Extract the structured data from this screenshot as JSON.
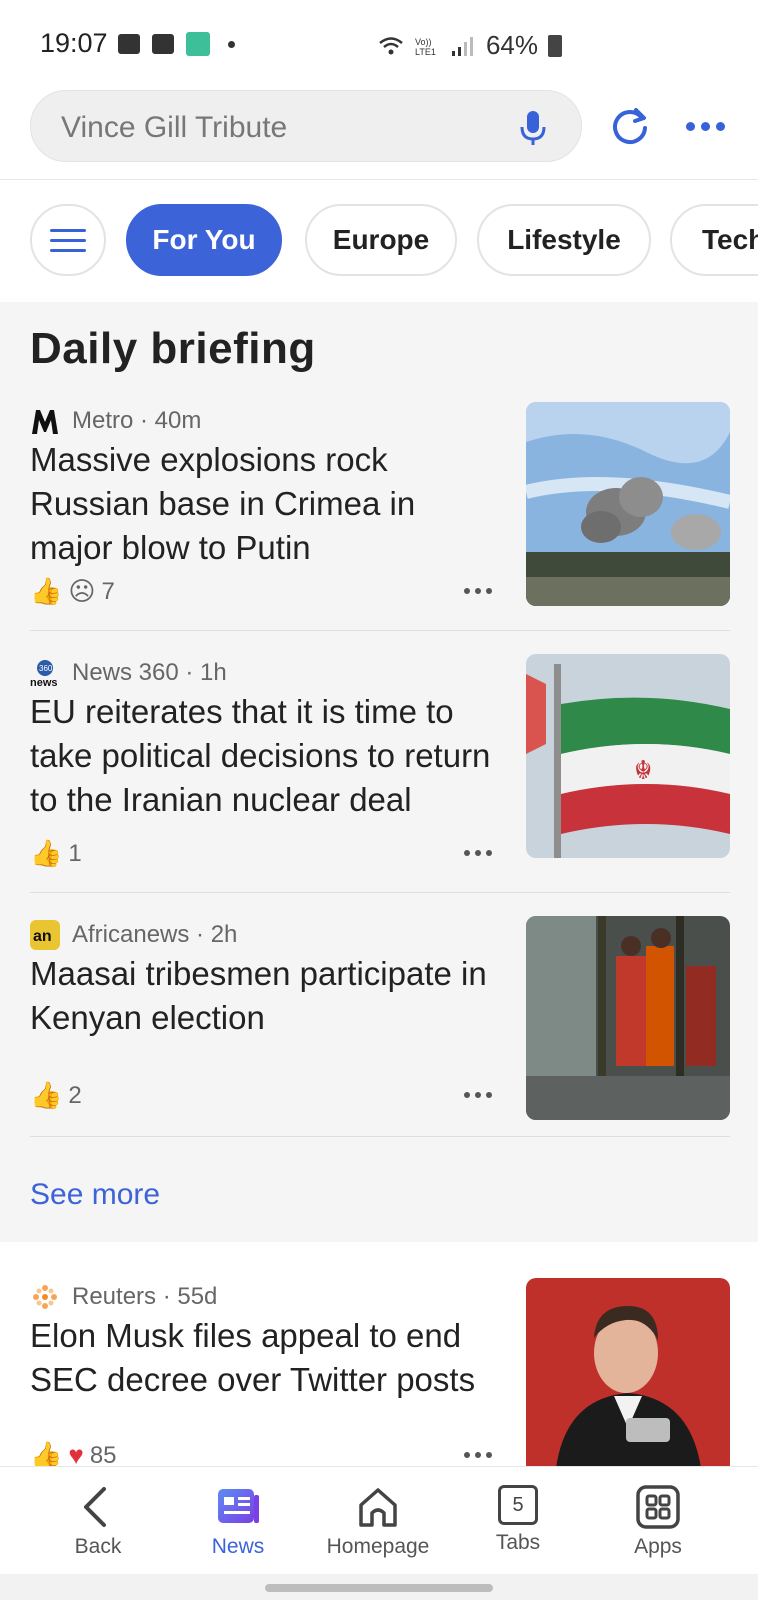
{
  "status_bar": {
    "time": "19:07",
    "battery": "64%",
    "icons": [
      "image-icon",
      "card-icon",
      "app-icon",
      "wifi-icon",
      "volte-icon",
      "signal-icon",
      "battery-icon"
    ]
  },
  "search": {
    "placeholder": "Vince Gill Tribute"
  },
  "tabs": [
    {
      "label": "For You",
      "active": true
    },
    {
      "label": "Europe",
      "active": false
    },
    {
      "label": "Lifestyle",
      "active": false
    },
    {
      "label": "Tech",
      "active": false
    }
  ],
  "section_title": "Daily briefing",
  "articles": [
    {
      "source": "Metro",
      "age": "40m",
      "source_line": "Metro · 40m",
      "title": "Massive explosions rock Russian base in Crimea in major blow to Putin",
      "reaction_count": "7",
      "image": "smoke-cloud-photo"
    },
    {
      "source": "News 360",
      "age": "1h",
      "source_line": "News 360 · 1h",
      "title": "EU reiterates that it is time to take political decisions to return to the Iranian nuclear deal",
      "reaction_count": "1",
      "image": "iran-flag-photo"
    },
    {
      "source": "Africanews",
      "age": "2h",
      "source_line": "Africanews · 2h",
      "title": "Maasai tribesmen participate in Kenyan election",
      "reaction_count": "2",
      "image": "maasai-voters-photo"
    }
  ],
  "see_more": "See more",
  "lower_article": {
    "source": "Reuters",
    "age": "55d",
    "source_line": "Reuters · 55d",
    "title": "Elon Musk files appeal to end SEC decree over Twitter posts",
    "reaction_count": "85",
    "image": "elon-musk-photo"
  },
  "bottom_nav": [
    {
      "label": "Back",
      "icon": "back-icon",
      "active": false
    },
    {
      "label": "News",
      "icon": "news-icon",
      "active": true
    },
    {
      "label": "Homepage",
      "icon": "home-icon",
      "active": false
    },
    {
      "label": "Tabs",
      "icon": "tabs-icon",
      "badge": "5",
      "active": false
    },
    {
      "label": "Apps",
      "icon": "apps-icon",
      "active": false
    }
  ],
  "colors": {
    "accent": "#3d63d8",
    "background": "#f5f5f5",
    "text": "#222222"
  }
}
